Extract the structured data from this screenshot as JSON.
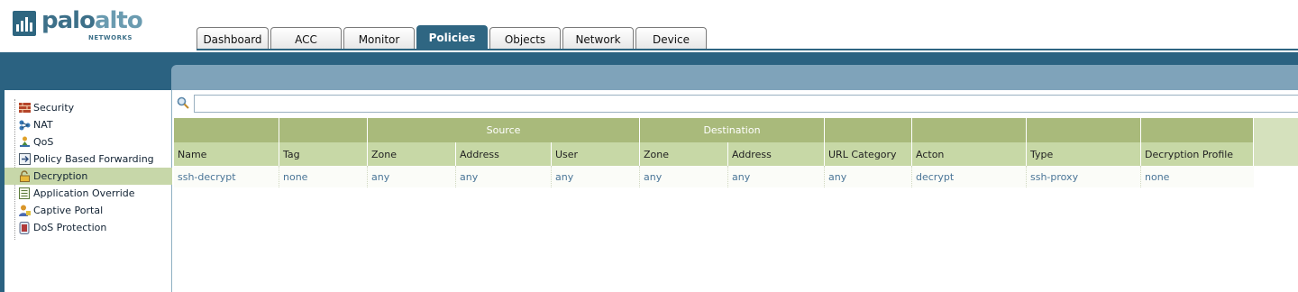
{
  "brand": {
    "name_part1": "palo",
    "name_part2": "alto",
    "sub": "NETWORKS"
  },
  "tabs": [
    {
      "label": "Dashboard",
      "active": false
    },
    {
      "label": "ACC",
      "active": false
    },
    {
      "label": "Monitor",
      "active": false
    },
    {
      "label": "Policies",
      "active": true
    },
    {
      "label": "Objects",
      "active": false
    },
    {
      "label": "Network",
      "active": false
    },
    {
      "label": "Device",
      "active": false
    }
  ],
  "sidebar": {
    "items": [
      {
        "label": "Security",
        "icon": "security-icon",
        "active": false
      },
      {
        "label": "NAT",
        "icon": "nat-icon",
        "active": false
      },
      {
        "label": "QoS",
        "icon": "qos-icon",
        "active": false
      },
      {
        "label": "Policy Based Forwarding",
        "icon": "pbf-icon",
        "active": false
      },
      {
        "label": "Decryption",
        "icon": "decryption-lock-icon",
        "active": true
      },
      {
        "label": "Application Override",
        "icon": "application-override-icon",
        "active": false
      },
      {
        "label": "Captive Portal",
        "icon": "captive-portal-icon",
        "active": false
      },
      {
        "label": "DoS Protection",
        "icon": "dos-protection-icon",
        "active": false
      }
    ]
  },
  "search": {
    "placeholder": "",
    "value": ""
  },
  "table": {
    "groups": {
      "source": "Source",
      "destination": "Destination"
    },
    "columns": [
      "Name",
      "Tag",
      "Zone",
      "Address",
      "User",
      "Zone",
      "Address",
      "URL Category",
      "Acton",
      "Type",
      "Decryption Profile"
    ],
    "rows": [
      [
        "ssh-decrypt",
        "none",
        "any",
        "any",
        "any",
        "any",
        "any",
        "any",
        "decrypt",
        "ssh-proxy",
        "none"
      ]
    ]
  },
  "colors": {
    "header_blue": "#2b6281",
    "band_light": "#7fa3ba",
    "group_header": "#a9ba7b",
    "column_header": "#c7d8a6",
    "active_item": "#c7d7a9",
    "cell_text": "#4a7597"
  }
}
